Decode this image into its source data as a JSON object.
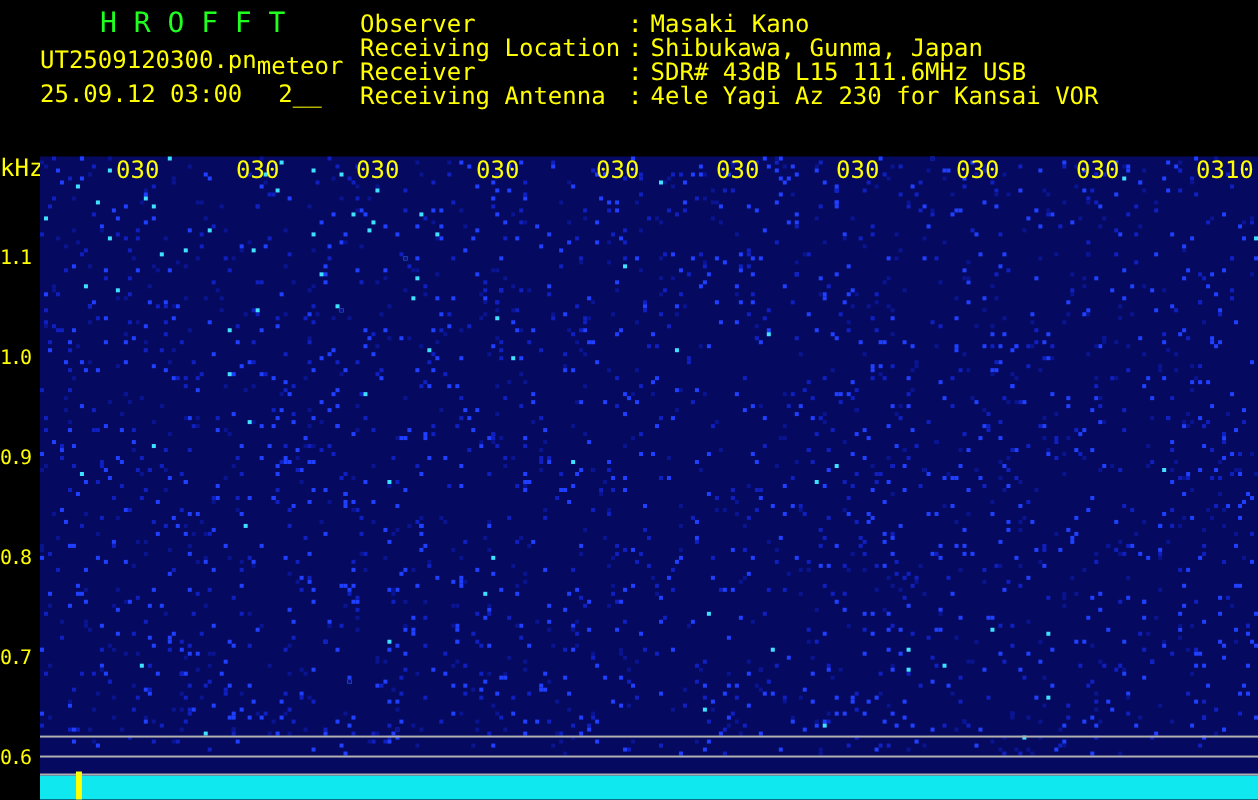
{
  "header": {
    "title": "H R O F F T",
    "filename": "UT2509120300.pn",
    "mode": "meteor",
    "datetime": "25.09.12 03:00",
    "code": "2__"
  },
  "station_info": [
    {
      "label": "Observer",
      "separator": ":",
      "value": "Masaki Kano"
    },
    {
      "label": "Receiving Location",
      "separator": ":",
      "value": "Shibukawa, Gunma, Japan"
    },
    {
      "label": "Receiver",
      "separator": ":",
      "value": "SDR# 43dB L15 111.6MHz USB"
    },
    {
      "label": "Receiving Antenna",
      "separator": ":",
      "value": "4ele Yagi Az 230 for Kansai VOR"
    }
  ],
  "spectrogram": {
    "y_unit": "kHz",
    "y_labels": [
      "1.1",
      "1.0",
      "0.9",
      "0.8",
      "0.7",
      "0.6"
    ],
    "time_labels": [
      "030",
      "030",
      "030",
      "030",
      "030",
      "030",
      "030",
      "030",
      "030",
      "0310"
    ]
  }
}
